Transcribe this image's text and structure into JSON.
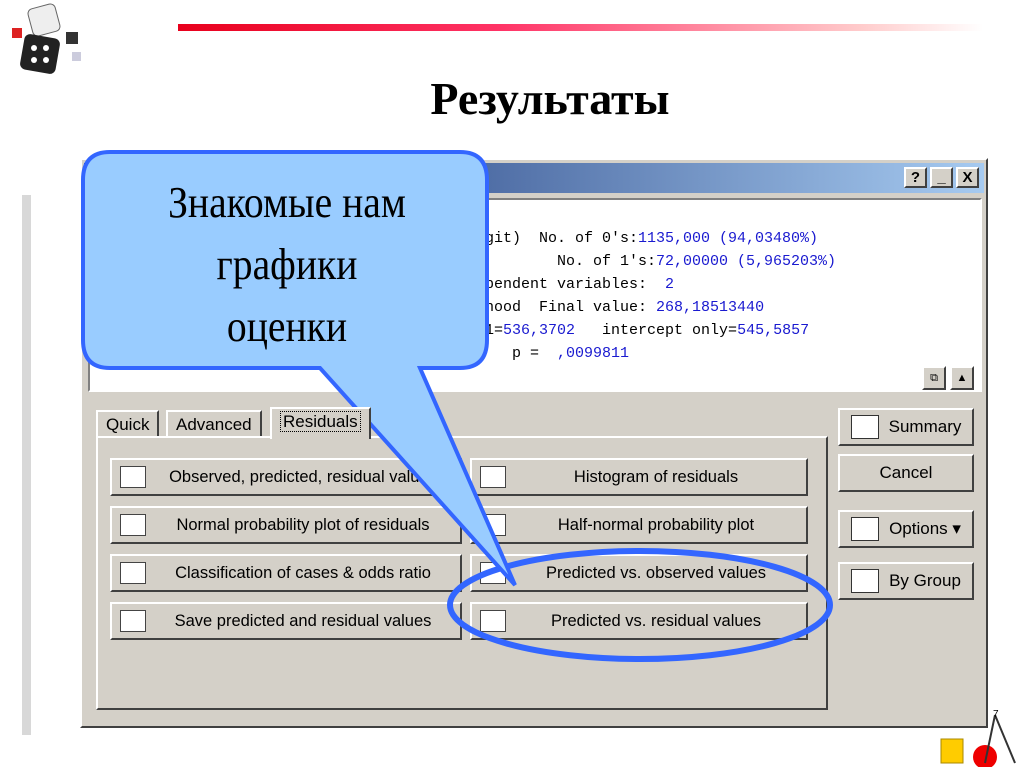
{
  "slide": {
    "title": "Результаты",
    "callout": [
      "Знакомые нам",
      "графики",
      "оценки"
    ]
  },
  "window": {
    "help": "?",
    "minimize": "_",
    "close": "X"
  },
  "output": {
    "lines": [
      [
        [
          "git)  No. of 0's:",
          ""
        ],
        [
          "1135,000 (94,03480%)",
          "v"
        ]
      ],
      [
        [
          "        No. of 1's:",
          ""
        ],
        [
          "72,00000 (5,965203%)",
          "v"
        ]
      ],
      [
        [
          "pendent variables:  ",
          ""
        ],
        [
          "2",
          "v"
        ]
      ],
      [
        [
          "hood",
          ""
        ],
        [
          "  Final value: ",
          ""
        ],
        [
          "268,18513440",
          "v"
        ]
      ],
      [
        [
          "1=",
          ""
        ],
        [
          "536,3702",
          "v"
        ],
        [
          "   intercept only=",
          ""
        ],
        [
          "545,5857",
          "v"
        ]
      ],
      [
        [
          "   p =  ",
          ""
        ],
        [
          ",0099811",
          "v"
        ]
      ]
    ]
  },
  "tabs": [
    {
      "label": "Quick"
    },
    {
      "label": "Advanced"
    },
    {
      "label": "Residuals",
      "active": true
    }
  ],
  "buttons": [
    {
      "label": "Observed, predicted, residual values",
      "icon": "table-icon"
    },
    {
      "label": "Histogram of residuals",
      "icon": "histogram-icon"
    },
    {
      "label": "Normal probability plot of residuals",
      "icon": "normal-plot-icon"
    },
    {
      "label": "Half-normal probability plot",
      "icon": "half-normal-plot-icon"
    },
    {
      "label": "Classification of cases & odds ratio",
      "icon": "table-icon"
    },
    {
      "label": "Predicted vs. observed values",
      "icon": "scatter-icon"
    },
    {
      "label": "Save predicted and residual values",
      "icon": "save-table-icon"
    },
    {
      "label": "Predicted vs. residual values",
      "icon": "scatter-icon"
    }
  ],
  "side_buttons": [
    {
      "label": "Summary",
      "icon": "summary-icon"
    },
    {
      "label": "Cancel"
    },
    {
      "label": "Options ▾",
      "icon": "options-icon"
    },
    {
      "label": "By Group",
      "icon": "by-group-icon"
    }
  ],
  "colors": {
    "callout_fill": "#99ccff",
    "callout_border": "#3366ff",
    "highlight_ellipse": "#3366ff",
    "title_bar": "#0a246a",
    "accent_line": "#e8001c"
  }
}
